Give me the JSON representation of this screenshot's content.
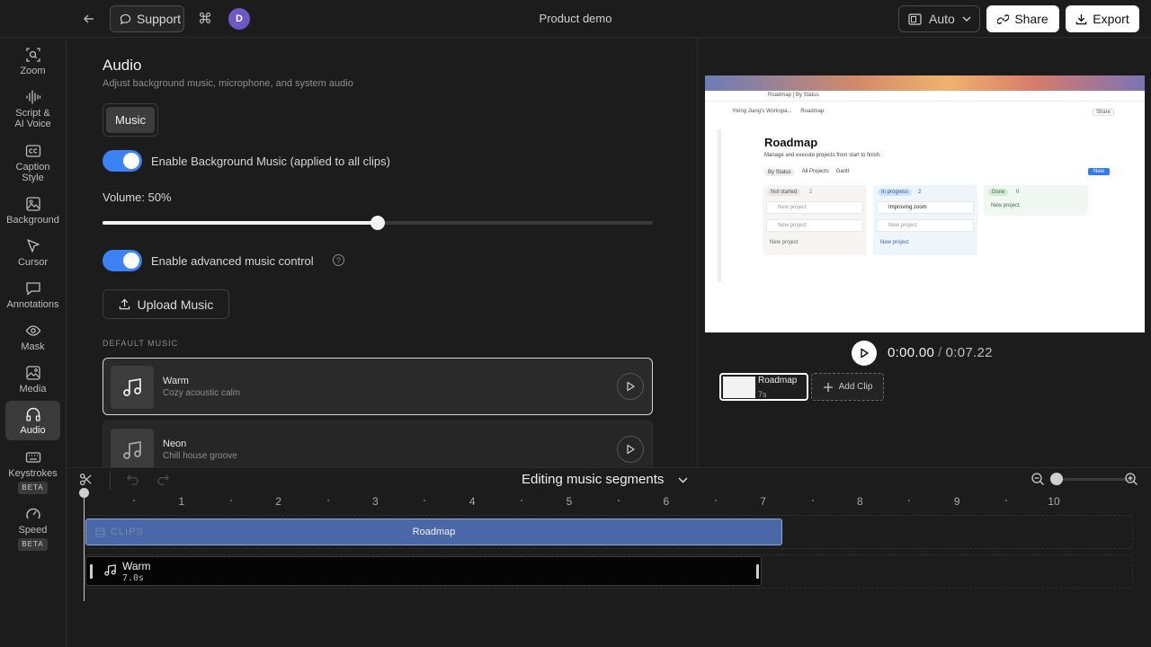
{
  "header": {
    "support_label": "Support",
    "avatar_initial": "D",
    "project_title": "Product demo",
    "aspect_label": "Auto",
    "share_label": "Share",
    "export_label": "Export"
  },
  "sidebar": {
    "items": [
      {
        "label": "Zoom"
      },
      {
        "label": "Script &\nAI Voice"
      },
      {
        "label": "Caption\nStyle"
      },
      {
        "label": "Background"
      },
      {
        "label": "Cursor"
      },
      {
        "label": "Annotations"
      },
      {
        "label": "Mask"
      },
      {
        "label": "Media"
      },
      {
        "label": "Audio"
      },
      {
        "label": "Keystrokes",
        "badge": "BETA"
      },
      {
        "label": "Speed",
        "badge": "BETA"
      }
    ],
    "active": "Audio"
  },
  "audio": {
    "title": "Audio",
    "subtitle": "Adjust background music, microphone, and system audio",
    "tab_music": "Music",
    "bg_music_toggle_label": "Enable Background Music (applied to all clips)",
    "bg_music_enabled": true,
    "volume_label": "Volume: 50%",
    "volume_fraction": 0.5,
    "advanced_toggle_label": "Enable advanced music control",
    "advanced_enabled": true,
    "help_glyph": "?",
    "upload_label": "Upload Music",
    "default_music_label": "DEFAULT MUSIC",
    "tracks": [
      {
        "name": "Warm",
        "desc": "Cozy acoustic calm",
        "selected": true
      },
      {
        "name": "Neon",
        "desc": "Chill house groove",
        "selected": false
      }
    ]
  },
  "preview": {
    "page_tab": "Roadmap | By Status",
    "breadcrumb_workspace": "Yixing Jiang's Workspa...",
    "breadcrumb_page": "Roadmap",
    "share": "Share",
    "heading": "Roadmap",
    "description": "Manage and execute projects from start to finish.",
    "views": [
      "By Status",
      "All Projects",
      "Gantt"
    ],
    "new_button": "New",
    "columns": [
      {
        "status": "Not started",
        "count": "2",
        "cards": [
          "New project",
          "New project"
        ],
        "add": "New project"
      },
      {
        "status": "In progress",
        "count": "2",
        "cards": [
          "Improving zoom",
          "New project"
        ],
        "add": "New project"
      },
      {
        "status": "Done",
        "count": "0",
        "cards": [],
        "add": "New project"
      }
    ],
    "current_time": "0:00.00",
    "separator": "/",
    "total_time": "0:07.22",
    "clip_name": "Roadmap",
    "clip_duration": "7s",
    "add_clip_label": "Add Clip"
  },
  "timeline": {
    "mode_label": "Editing music segments",
    "ruler_numbers": [
      "1",
      "2",
      "3",
      "4",
      "5",
      "6",
      "7",
      "8",
      "9",
      "10"
    ],
    "clip_track_ghost": "CLIPS",
    "clip_bar_label": "Roadmap",
    "music_name": "Warm",
    "music_duration": "7.0s",
    "playhead_seconds": 0,
    "zoom_fraction": 0
  },
  "colors": {
    "accent": "#3b82f6",
    "clip_bar": "#4a68a8",
    "avatar": "#6e57c7"
  }
}
